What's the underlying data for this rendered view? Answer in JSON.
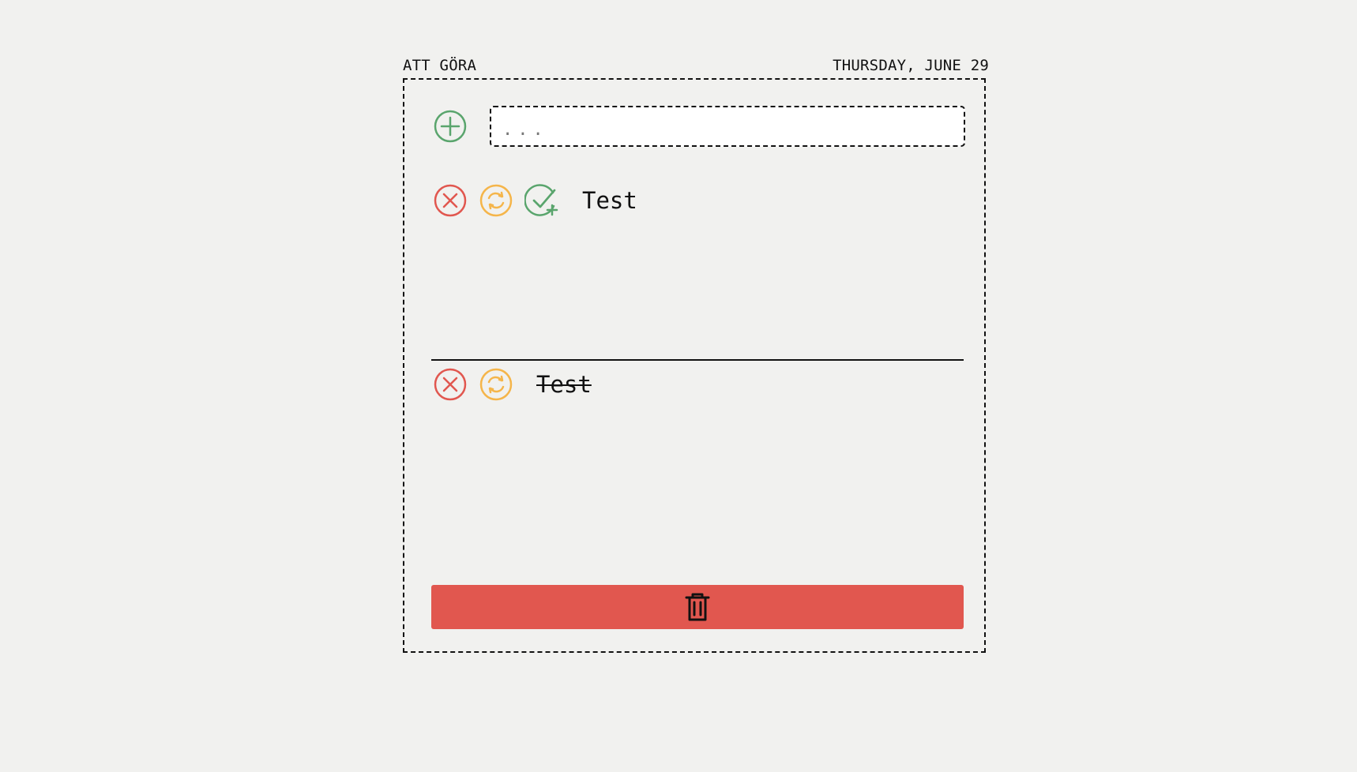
{
  "header": {
    "title": "ATT GÖRA",
    "date": "THURSDAY, JUNE 29"
  },
  "new_task": {
    "placeholder": "...",
    "value": ""
  },
  "tasks": {
    "active": [
      {
        "text": "Test"
      }
    ],
    "done": [
      {
        "text": "Test"
      }
    ]
  },
  "icons": {
    "add": "plus-circle-icon",
    "delete": "x-circle-icon",
    "restore": "refresh-circle-icon",
    "complete": "check-plus-icon",
    "clear_all": "trash-icon"
  },
  "colors": {
    "background": "#f1f1ef",
    "green": "#5aa56d",
    "red": "#e1574f",
    "orange": "#f5b54a",
    "text": "#111111"
  }
}
